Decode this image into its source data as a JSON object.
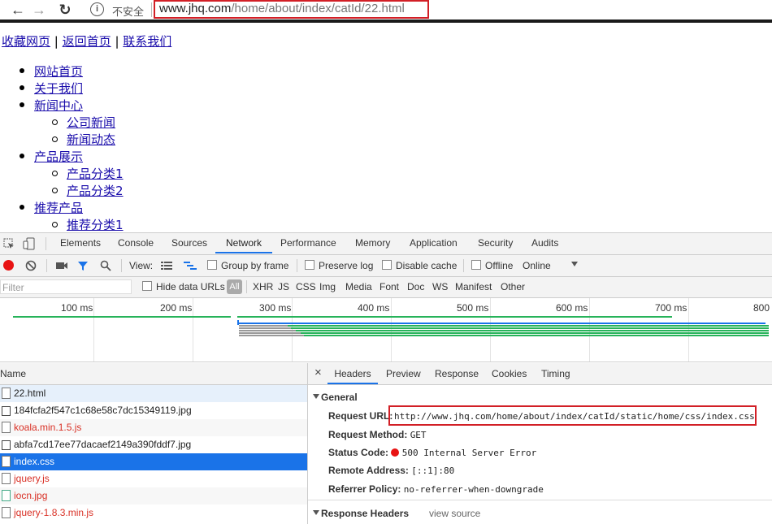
{
  "browser": {
    "insecure_label": "不安全",
    "url_host": "www.jhq.com",
    "url_path": "/home/about/index/catId/22.html",
    "back_glyph": "←",
    "forward_glyph": "→",
    "reload_glyph": "↻",
    "info_glyph": "i",
    "highlight_color": "#d21f26"
  },
  "page": {
    "top_links": [
      "收藏网页",
      "返回首页",
      "联系我们"
    ],
    "top_sep": "|",
    "nav": [
      {
        "label": "网站首页"
      },
      {
        "label": "关于我们"
      },
      {
        "label": "新闻中心",
        "children": [
          "公司新闻",
          "新闻动态"
        ]
      },
      {
        "label": "产品展示",
        "children": [
          "产品分类1",
          "产品分类2"
        ]
      },
      {
        "label": "推荐产品",
        "children": [
          "推荐分类1"
        ]
      }
    ]
  },
  "devtools": {
    "tabs": [
      "Elements",
      "Console",
      "Sources",
      "Network",
      "Performance",
      "Memory",
      "Application",
      "Security",
      "Audits"
    ],
    "active_tab": "Network",
    "toolbar": {
      "view_label": "View:",
      "group_by_frame": "Group by frame",
      "preserve_log": "Preserve log",
      "disable_cache": "Disable cache",
      "offline": "Offline",
      "throttle": "Online"
    },
    "filter": {
      "placeholder": "Filter",
      "hide_data_urls": "Hide data URLs",
      "types": [
        "All",
        "XHR",
        "JS",
        "CSS",
        "Img",
        "Media",
        "Font",
        "Doc",
        "WS",
        "Manifest",
        "Other"
      ]
    },
    "timeline_ticks": [
      "100 ms",
      "200 ms",
      "300 ms",
      "400 ms",
      "500 ms",
      "600 ms",
      "700 ms",
      "800"
    ],
    "name_header": "Name",
    "files": [
      {
        "name": "22.html",
        "status": "selected-light"
      },
      {
        "name": "184fcfa2f547c1c68e58c7dc15349119.jpg",
        "status": "ok"
      },
      {
        "name": "koala.min.1.5.js",
        "status": "error"
      },
      {
        "name": "abfa7cd17ee77dacaef2149a390fddf7.jpg",
        "status": "ok"
      },
      {
        "name": "index.css",
        "status": "selected"
      },
      {
        "name": "jquery.js",
        "status": "error"
      },
      {
        "name": "iocn.jpg",
        "status": "error"
      },
      {
        "name": "jquery-1.8.3.min.js",
        "status": "error"
      }
    ],
    "detail_tabs": [
      "Headers",
      "Preview",
      "Response",
      "Cookies",
      "Timing"
    ],
    "close_glyph": "×",
    "general_label": "General",
    "general": [
      {
        "key": "Request URL:",
        "value": "http://www.jhq.com/home/about/index/catId/static/home/css/index.css"
      },
      {
        "key": "Request Method:",
        "value": "GET"
      },
      {
        "key": "Status Code:",
        "value": "500 Internal Server Error"
      },
      {
        "key": "Remote Address:",
        "value": "[::1]:80"
      },
      {
        "key": "Referrer Policy:",
        "value": "no-referrer-when-downgrade"
      }
    ],
    "response_headers_label": "Response Headers",
    "view_source": "view source",
    "colors": {
      "accent": "#1a73e8",
      "selected_row": "#1a73e8",
      "error_text": "#d93025",
      "record_red": "#e81313",
      "bar_green": "#27b35a"
    }
  }
}
